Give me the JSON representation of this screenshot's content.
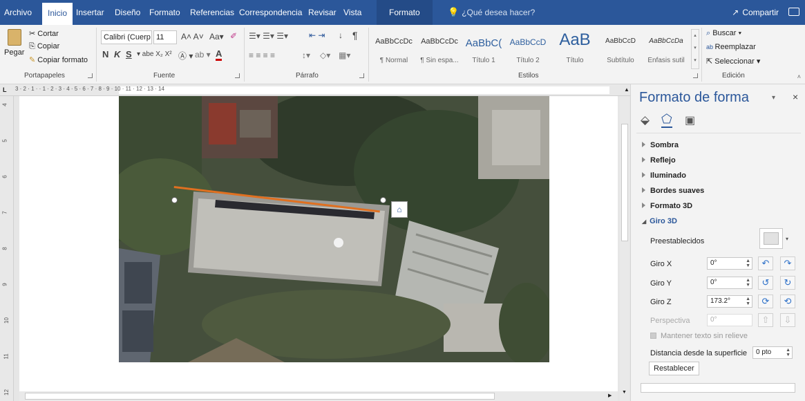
{
  "menu": {
    "tabs": [
      "Archivo",
      "Inicio",
      "Insertar",
      "Diseño",
      "Formato",
      "Referencias",
      "Correspondencia",
      "Revisar",
      "Vista"
    ],
    "context_tab": "Formato",
    "tellme": "¿Qué desea hacer?",
    "share": "Compartir"
  },
  "ribbon": {
    "clipboard": {
      "paste": "Pegar",
      "cut": "Cortar",
      "copy": "Copiar",
      "format_painter": "Copiar formato",
      "label": "Portapapeles"
    },
    "font": {
      "font_name": "Calibri (Cuerp",
      "font_size": "11",
      "label": "Fuente"
    },
    "paragraph": {
      "label": "Párrafo"
    },
    "styles": {
      "label": "Estilos",
      "items": [
        {
          "sample": "AaBbCcDc",
          "name": "¶ Normal"
        },
        {
          "sample": "AaBbCcDc",
          "name": "¶ Sin espa..."
        },
        {
          "sample": "AaBbC(",
          "name": "Título 1"
        },
        {
          "sample": "AaBbCcD",
          "name": "Título 2"
        },
        {
          "sample": "AaB",
          "name": "Título"
        },
        {
          "sample": "AaBbCcD",
          "name": "Subtítulo"
        },
        {
          "sample": "AaBbCcDa",
          "name": "Énfasis sutil"
        }
      ]
    },
    "editing": {
      "find": "Buscar",
      "replace": "Reemplazar",
      "select": "Seleccionar",
      "label": "Edición"
    }
  },
  "ruler": {
    "numbers": "3 · 2 · 1 · · 1 · 2 · 3 · 4 · 5 · 6 · 7 · 8 · 9 · 10 · 11 · 12 · 13 · 14"
  },
  "vruler": {
    "numbers": [
      "4",
      "5",
      "6",
      "7",
      "8",
      "9",
      "10",
      "11",
      "12"
    ]
  },
  "pane": {
    "title": "Formato de forma",
    "sections": [
      "Sombra",
      "Reflejo",
      "Iluminado",
      "Bordes suaves",
      "Formato 3D"
    ],
    "expanded": "Giro 3D",
    "presets_label": "Preestablecidos",
    "rot_x_label": "Giro X",
    "rot_x": "0°",
    "rot_y_label": "Giro Y",
    "rot_y": "0°",
    "rot_z_label": "Giro Z",
    "rot_z": "173.2°",
    "perspective_label": "Perspectiva",
    "perspective": "0°",
    "keep_flat": "Mantener texto sin relieve",
    "distance_label": "Distancia desde la superficie",
    "distance": "0 pto",
    "reset": "Restablecer"
  },
  "colors": {
    "accent": "#2b579a",
    "line": "#e07020"
  }
}
